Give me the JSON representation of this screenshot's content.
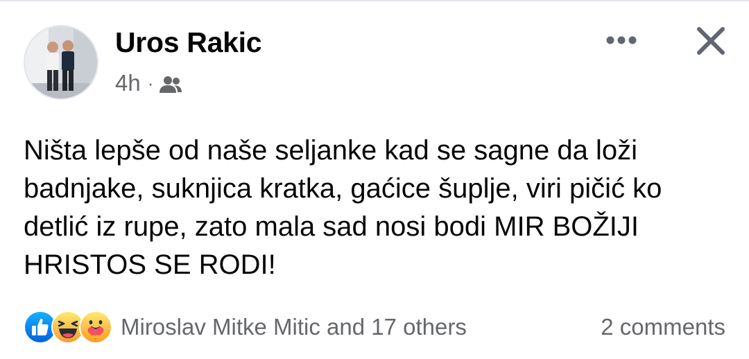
{
  "post": {
    "author": "Uros Rakic",
    "time": "4h",
    "separator": "·",
    "audience_icon": "friends-icon",
    "text": "Ništa lepše od naše seljanke kad se sagne da loži\nbadnjake, suknjica kratka, gaćice šuplje, viri pičić ko\ndetlić iz rupe, zato mala sad nosi bodi MIR BOŽIJI\nHRISTOS SE RODI!"
  },
  "actions": {
    "more_icon": "more-horizontal-icon",
    "close_icon": "close-icon"
  },
  "footer": {
    "reaction_icons": [
      "like-icon",
      "haha-icon",
      "care-icon"
    ],
    "reactors": "Miroslav Mitke Mitic and 17 others",
    "comments": "2 comments"
  },
  "colors": {
    "text_primary": "#050505",
    "text_secondary": "#65676b",
    "like_blue": "#1877f2",
    "icon_gray": "#606770"
  }
}
